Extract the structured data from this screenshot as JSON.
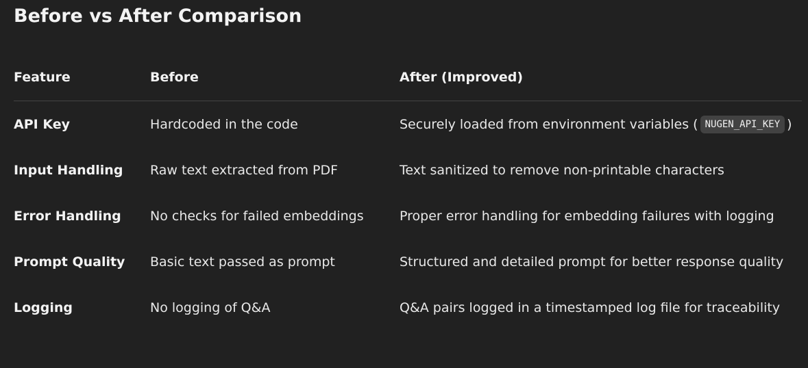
{
  "heading": "Before vs After Comparison",
  "table": {
    "columns": [
      "Feature",
      "Before",
      "After (Improved)"
    ],
    "rows": [
      {
        "feature": "API Key",
        "before": "Hardcoded in the code",
        "after_prefix": "Securely loaded from environment variables (",
        "after_code": "NUGEN_API_KEY",
        "after_suffix": ")"
      },
      {
        "feature": "Input Handling",
        "before": "Raw text extracted from PDF",
        "after": "Text sanitized to remove non-printable characters"
      },
      {
        "feature": "Error Handling",
        "before": "No checks for failed embeddings",
        "after": "Proper error handling for embedding failures with logging"
      },
      {
        "feature": "Prompt Quality",
        "before": "Basic text passed as prompt",
        "after": "Structured and detailed prompt for better response quality"
      },
      {
        "feature": "Logging",
        "before": "No logging of Q&A",
        "after": "Q&A pairs logged in a timestamped log file for traceability"
      }
    ]
  }
}
